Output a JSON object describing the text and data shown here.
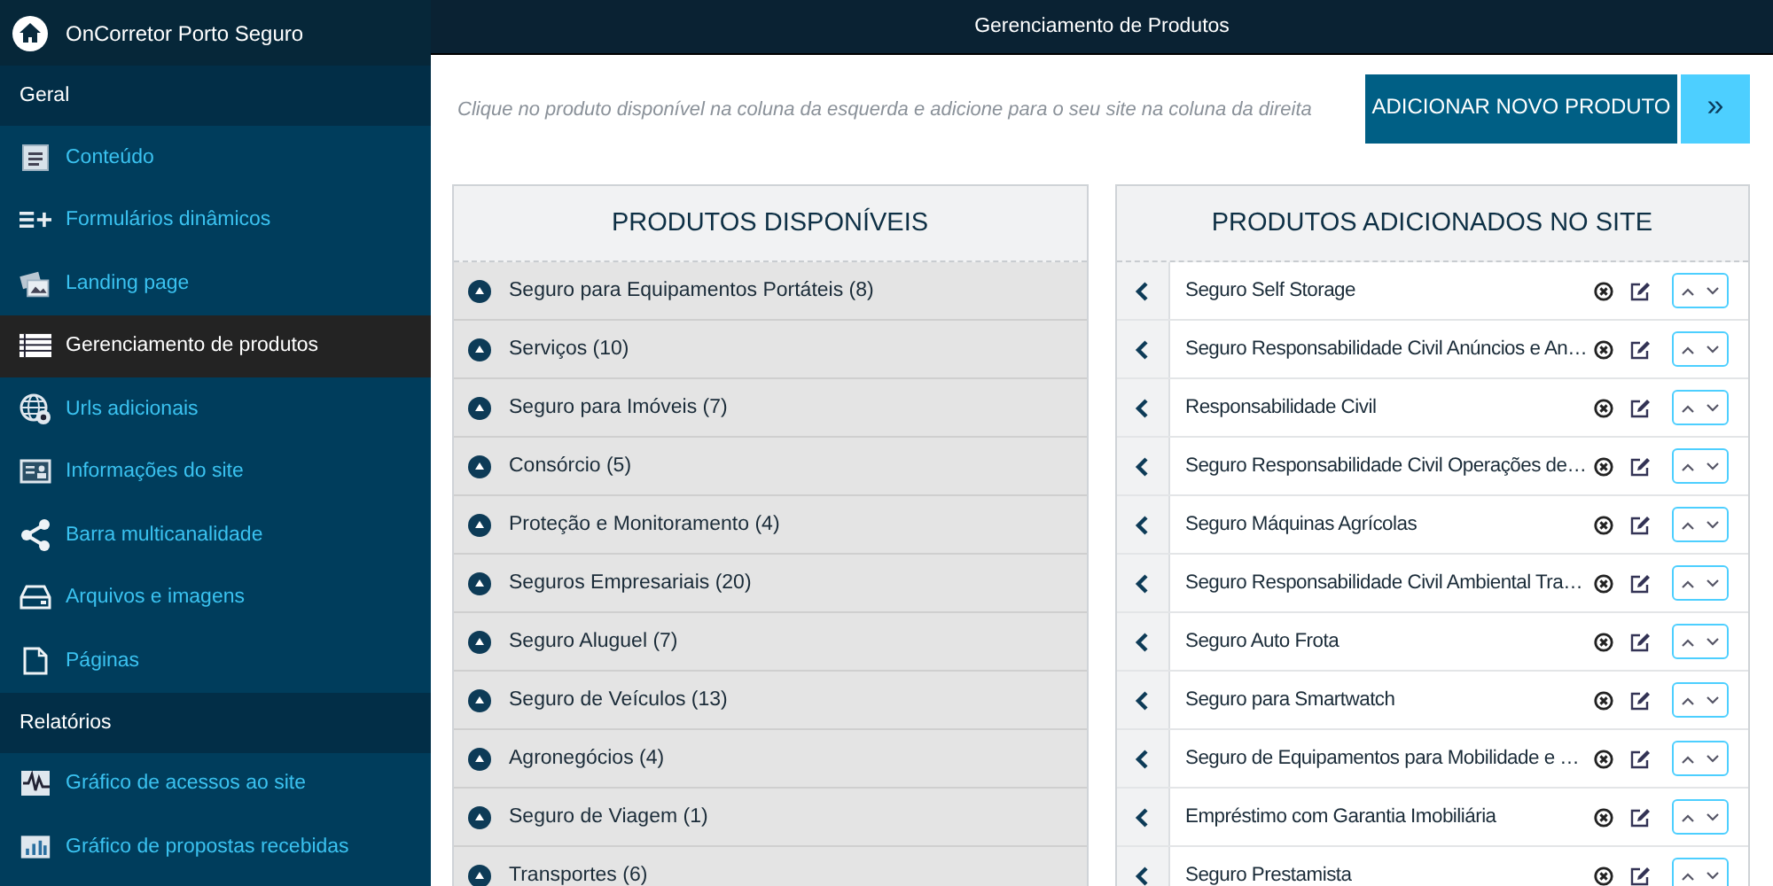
{
  "sidebar": {
    "brand": "OnCorretor Porto Seguro",
    "sections": [
      {
        "title": "Geral",
        "items": [
          {
            "label": "Conteúdo",
            "selected": false
          },
          {
            "label": "Formulários dinâmicos",
            "selected": false
          },
          {
            "label": "Landing page",
            "selected": false
          },
          {
            "label": "Gerenciamento de produtos",
            "selected": true
          },
          {
            "label": "Urls adicionais",
            "selected": false
          },
          {
            "label": "Informações do site",
            "selected": false
          },
          {
            "label": "Barra multicanalidade",
            "selected": false
          },
          {
            "label": "Arquivos e imagens",
            "selected": false
          },
          {
            "label": "Páginas",
            "selected": false
          }
        ]
      },
      {
        "title": "Relatórios",
        "items": [
          {
            "label": "Gráfico de acessos ao site",
            "selected": false
          },
          {
            "label": "Gráfico de propostas recebidas",
            "selected": false
          }
        ]
      }
    ]
  },
  "header": {
    "title": "Gerenciamento de Produtos"
  },
  "toolbar": {
    "hint": "Clique no produto disponível na coluna da esquerda e adicione para o seu site na coluna da direita",
    "add_button": "ADICIONAR NOVO PRODUTO",
    "expand_button": "»"
  },
  "available_panel": {
    "title": "PRODUTOS DISPONÍVEIS",
    "categories": [
      {
        "label": "Seguro para Equipamentos Portáteis (8)"
      },
      {
        "label": "Serviços (10)"
      },
      {
        "label": "Seguro para Imóveis (7)"
      },
      {
        "label": "Consórcio (5)"
      },
      {
        "label": "Proteção e Monitoramento (4)"
      },
      {
        "label": "Seguros Empresariais (20)"
      },
      {
        "label": "Seguro Aluguel (7)"
      },
      {
        "label": "Seguro de Veículos (13)"
      },
      {
        "label": "Agronegócios (4)"
      },
      {
        "label": "Seguro de Viagem (1)"
      },
      {
        "label": "Transportes (6)"
      }
    ]
  },
  "added_panel": {
    "title": "PRODUTOS ADICIONADOS NO SITE",
    "products": [
      {
        "name": "Seguro Self Storage"
      },
      {
        "name": "Seguro Responsabilidade Civil Anúncios e An…"
      },
      {
        "name": "Responsabilidade Civil"
      },
      {
        "name": "Seguro Responsabilidade Civil Operações de…"
      },
      {
        "name": "Seguro Máquinas Agrícolas"
      },
      {
        "name": "Seguro Responsabilidade Civil Ambiental Tra…"
      },
      {
        "name": "Seguro Auto Frota"
      },
      {
        "name": "Seguro para Smartwatch"
      },
      {
        "name": "Seguro de Equipamentos para Mobilidade e …"
      },
      {
        "name": "Empréstimo com Garantia Imobiliária"
      },
      {
        "name": "Seguro Prestamista"
      }
    ]
  }
}
